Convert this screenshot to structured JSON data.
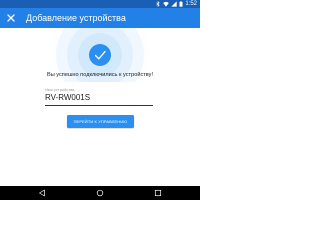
{
  "status_bar": {
    "time": "1:52",
    "icons": [
      "image-notification-icon",
      "bluetooth-icon",
      "wifi-icon",
      "signal-icon",
      "battery-icon"
    ]
  },
  "app_bar": {
    "title": "Добавление устройства",
    "close_icon": "close-icon"
  },
  "main": {
    "success_message": "Вы успешно подключились к устройству!",
    "device_name_label": "Имя устройства",
    "device_name_value": "RV-RW001S",
    "go_to_control_button": "ПЕРЕЙТИ К УПРАВЛЕНИЮ"
  },
  "nav_bar": {
    "icons": [
      "back-icon",
      "home-icon",
      "recent-apps-icon"
    ]
  },
  "colors": {
    "status_bar": "#1a5fb4",
    "app_bar": "#2280e6",
    "accent": "#2a8ff0",
    "ripple": "#cfe6fb"
  }
}
